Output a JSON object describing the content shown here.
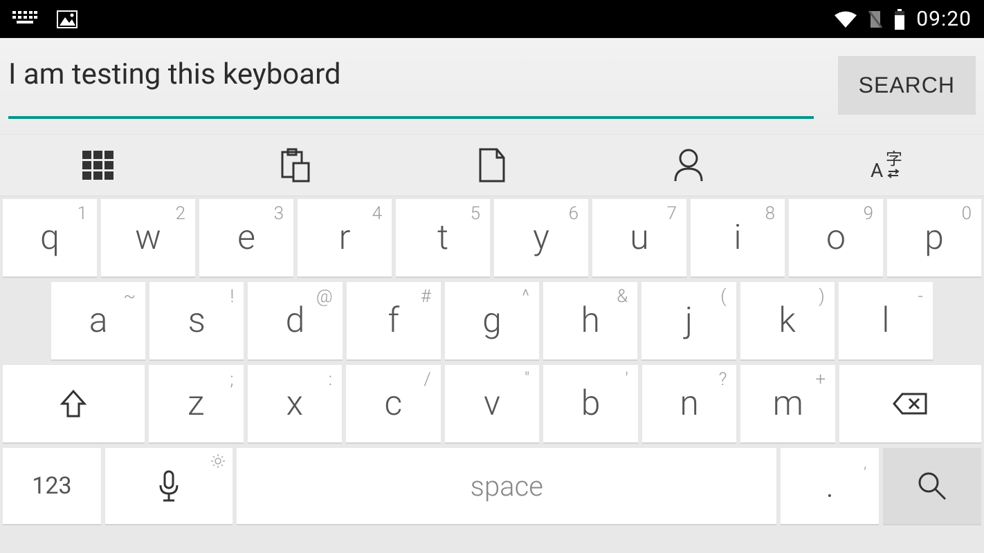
{
  "status": {
    "time": "09:20"
  },
  "search": {
    "text": "I am testing this keyboard",
    "button": "SEARCH"
  },
  "keys": {
    "row1": [
      {
        "main": "q",
        "hint": "1"
      },
      {
        "main": "w",
        "hint": "2"
      },
      {
        "main": "e",
        "hint": "3"
      },
      {
        "main": "r",
        "hint": "4"
      },
      {
        "main": "t",
        "hint": "5"
      },
      {
        "main": "y",
        "hint": "6"
      },
      {
        "main": "u",
        "hint": "7"
      },
      {
        "main": "i",
        "hint": "8"
      },
      {
        "main": "o",
        "hint": "9"
      },
      {
        "main": "p",
        "hint": "0"
      }
    ],
    "row2": [
      {
        "main": "a",
        "hint": "~"
      },
      {
        "main": "s",
        "hint": "!"
      },
      {
        "main": "d",
        "hint": "@"
      },
      {
        "main": "f",
        "hint": "#"
      },
      {
        "main": "g",
        "hint": "^"
      },
      {
        "main": "h",
        "hint": "&"
      },
      {
        "main": "j",
        "hint": "("
      },
      {
        "main": "k",
        "hint": ")"
      },
      {
        "main": "l",
        "hint": "-"
      }
    ],
    "row3": [
      {
        "main": "z",
        "hint": ";"
      },
      {
        "main": "x",
        "hint": ":"
      },
      {
        "main": "c",
        "hint": "/"
      },
      {
        "main": "v",
        "hint": "\""
      },
      {
        "main": "b",
        "hint": "'"
      },
      {
        "main": "n",
        "hint": "?"
      },
      {
        "main": "m",
        "hint": "+"
      }
    ],
    "num": "123",
    "space": "space",
    "period": {
      "main": ".",
      "hint": ","
    }
  }
}
